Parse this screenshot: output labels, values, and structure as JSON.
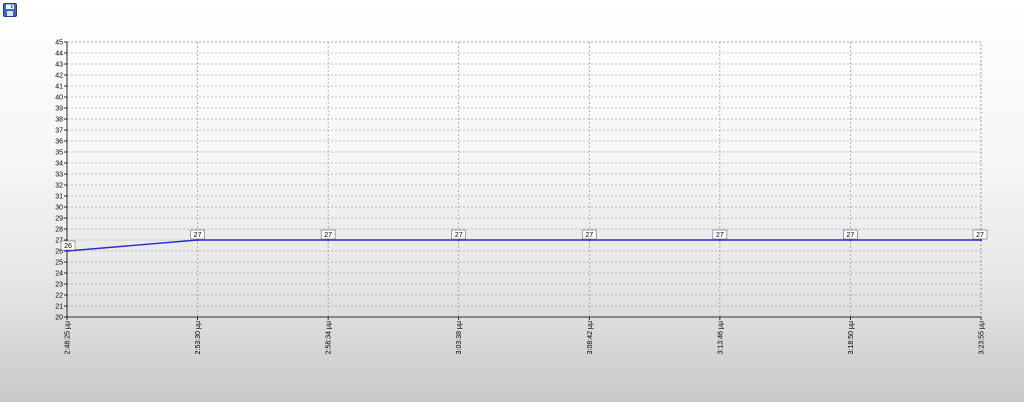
{
  "toolbar": {
    "save_icon": "floppy-disk-save-icon"
  },
  "colors": {
    "series_line": "#2a2ad8",
    "grid": "#8a8a8a",
    "axis": "#000000",
    "label_box_border": "#666666"
  },
  "chart_data": {
    "type": "line",
    "title": "",
    "xlabel": "",
    "ylabel": "",
    "ylim": [
      20,
      45
    ],
    "y_ticks": [
      20,
      21,
      22,
      23,
      24,
      25,
      26,
      27,
      28,
      29,
      30,
      31,
      32,
      33,
      34,
      35,
      36,
      37,
      38,
      39,
      40,
      41,
      42,
      43,
      44,
      45
    ],
    "x": [
      "2:48:25 μμ",
      "2:53:30 μμ",
      "2:58:34 μμ",
      "3:03:38 μμ",
      "3:08:42 μμ",
      "3:13:46 μμ",
      "3:18:50 μμ",
      "3:23:55 μμ"
    ],
    "series": [
      {
        "values": [
          26,
          27,
          27,
          27,
          27,
          27,
          27,
          27
        ]
      }
    ],
    "grid": true,
    "legend": "none",
    "data_labels": true
  }
}
